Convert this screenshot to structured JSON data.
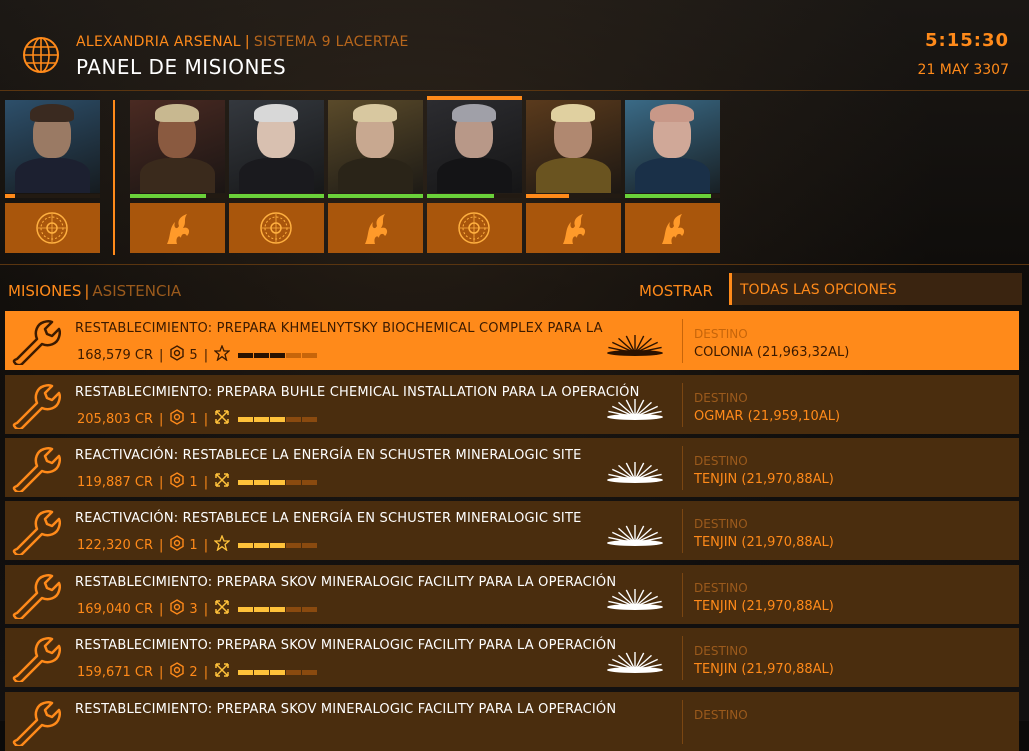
{
  "header": {
    "station": "ALEXANDRIA ARSENAL",
    "system": "SISTEMA 9 LACERTAE",
    "title": "PANEL DE MISIONES",
    "time": "5:15:30",
    "date": "21 MAY 3307"
  },
  "portraits": [
    {
      "faction_icon": "federation-seal-icon",
      "reputation": 0.1,
      "rep_color": "#ff8a1a",
      "selected": false
    },
    {
      "faction_icon": "phoenix-icon",
      "reputation": 0.8,
      "rep_color": "#6ad13a",
      "selected": false
    },
    {
      "faction_icon": "federation-seal-icon",
      "reputation": 1.0,
      "rep_color": "#6ad13a",
      "selected": false
    },
    {
      "faction_icon": "phoenix-icon",
      "reputation": 1.0,
      "rep_color": "#6ad13a",
      "selected": false
    },
    {
      "faction_icon": "federation-seal-icon",
      "reputation": 0.7,
      "rep_color": "#6ad13a",
      "selected": true
    },
    {
      "faction_icon": "phoenix-icon",
      "reputation": 0.45,
      "rep_color": "#ff8a1a",
      "selected": false
    },
    {
      "faction_icon": "phoenix-icon",
      "reputation": 0.9,
      "rep_color": "#6ad13a",
      "selected": false
    }
  ],
  "tabs": {
    "active": "MISIONES",
    "inactive": "ASISTENCIA",
    "show_label": "MOSTRAR",
    "filter": "TODAS LAS OPCIONES"
  },
  "missions": [
    {
      "title": "RESTABLECIMIENTO: PREPARA KHMELNYTSKY BIOCHEMICAL COMPLEX PARA LA",
      "reward": "168,579 CR",
      "rank": "5",
      "type_icon": "star-icon",
      "level": 3,
      "dest_label": "DESTINO",
      "destination": "COLONIA (21,963,32AL)",
      "selected": true
    },
    {
      "title": "RESTABLECIMIENTO: PREPARA BUHLE CHEMICAL INSTALLATION PARA LA OPERACIÓN",
      "reward": "205,803 CR",
      "rank": "1",
      "type_icon": "crossed-arrows-icon",
      "level": 3,
      "dest_label": "DESTINO",
      "destination": "OGMAR (21,959,10AL)",
      "selected": false
    },
    {
      "title": "REACTIVACIÓN: RESTABLECE LA ENERGÍA EN SCHUSTER MINERALOGIC SITE",
      "reward": "119,887 CR",
      "rank": "1",
      "type_icon": "crossed-arrows-icon",
      "level": 3,
      "dest_label": "DESTINO",
      "destination": "TENJIN (21,970,88AL)",
      "selected": false
    },
    {
      "title": "REACTIVACIÓN: RESTABLECE LA ENERGÍA EN SCHUSTER MINERALOGIC SITE",
      "reward": "122,320 CR",
      "rank": "1",
      "type_icon": "star-icon",
      "level": 3,
      "dest_label": "DESTINO",
      "destination": "TENJIN (21,970,88AL)",
      "selected": false
    },
    {
      "title": "RESTABLECIMIENTO: PREPARA SKOV MINERALOGIC FACILITY PARA LA OPERACIÓN",
      "reward": "169,040 CR",
      "rank": "3",
      "type_icon": "crossed-arrows-icon",
      "level": 3,
      "dest_label": "DESTINO",
      "destination": "TENJIN (21,970,88AL)",
      "selected": false
    },
    {
      "title": "RESTABLECIMIENTO: PREPARA SKOV MINERALOGIC FACILITY PARA LA OPERACIÓN",
      "reward": "159,671 CR",
      "rank": "2",
      "type_icon": "crossed-arrows-icon",
      "level": 3,
      "dest_label": "DESTINO",
      "destination": "TENJIN (21,970,88AL)",
      "selected": false
    },
    {
      "title": "RESTABLECIMIENTO: PREPARA SKOV MINERALOGIC FACILITY PARA LA OPERACIÓN",
      "reward": "",
      "rank": "",
      "type_icon": "",
      "level": 0,
      "dest_label": "DESTINO",
      "destination": "",
      "selected": false
    }
  ]
}
